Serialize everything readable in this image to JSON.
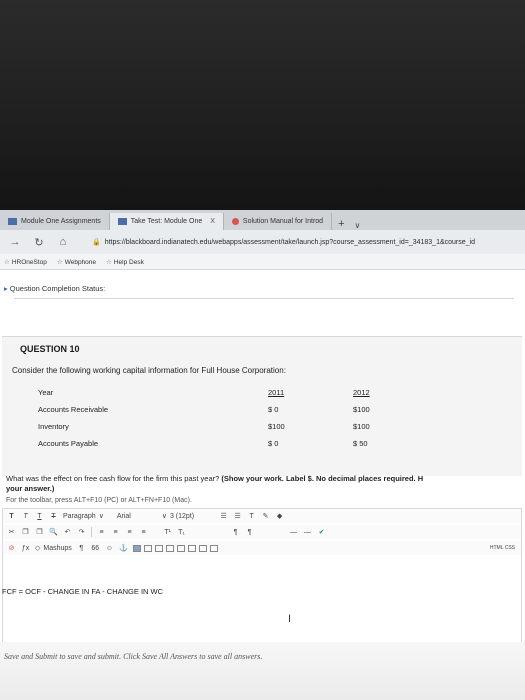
{
  "browser": {
    "tabs": [
      {
        "label": "Module One Assignments"
      },
      {
        "label": "Take Test: Module One"
      },
      {
        "label": "Solution Manual for Introd"
      }
    ],
    "close_glyph": "X",
    "new_tab_glyph": "+",
    "tab_menu_glyph": "∨",
    "url": "https://blackboard.indianatech.edu/webapps/assessment/take/launch.jsp?course_assessment_id=_34183_1&course_id",
    "favorites": [
      {
        "label": "HROneStop"
      },
      {
        "label": "Webphone"
      },
      {
        "label": "Help Desk"
      }
    ]
  },
  "page": {
    "completion_status": "Question Completion Status:",
    "question_number": "QUESTION 10",
    "prompt": "Consider the following working capital information for Full House Corporation:",
    "table": {
      "headers": [
        "Year",
        "2011",
        "2012"
      ],
      "rows": [
        [
          "Accounts Receivable",
          "$ 0",
          "$100"
        ],
        [
          "Inventory",
          "$100",
          "$100"
        ],
        [
          "Accounts Payable",
          "$ 0",
          "$ 50"
        ]
      ]
    },
    "question_plain": "What was the effect on free cash flow for the firm this past year? ",
    "question_bold": "(Show your work. Label $. No decimal places required. H",
    "question_bold_2": "your answer.)",
    "toolbar_hint": "For the toolbar, press ALT+F10 (PC) or ALT+FN+F10 (Mac).",
    "answer_text": "FCF = OCF - CHANGE IN FA - CHANGE IN WC",
    "footer_text": "Save and Submit to save and submit. Click Save All Answers to save all answers."
  },
  "editor": {
    "row1": {
      "format_buttons": [
        "T",
        "T",
        "T",
        "T"
      ],
      "paragraph": "Paragraph",
      "font": "Arial",
      "size": "3 (12pt)",
      "list_glyphs": [
        "☰",
        "☰",
        "T",
        "✎",
        "◆"
      ]
    },
    "row2": {
      "buttons": [
        "✂",
        "❐",
        "❐",
        "🔍",
        "↶",
        "↷"
      ],
      "align": [
        "≡",
        "≡",
        "≡",
        "≡"
      ],
      "script": [
        "T¹",
        "T₁"
      ],
      "misc": [
        "¶",
        "¶",
        "—",
        "—"
      ]
    },
    "row3": {
      "buttons": [
        "⊘",
        "ƒx"
      ],
      "mashups": "Mashups",
      "misc": [
        "¶",
        "66",
        "☺",
        "⚓"
      ],
      "html_label": "HTML CSS"
    }
  },
  "colors": {
    "accent": "#2f6fb1",
    "panel_bg": "#f4f4f4"
  }
}
